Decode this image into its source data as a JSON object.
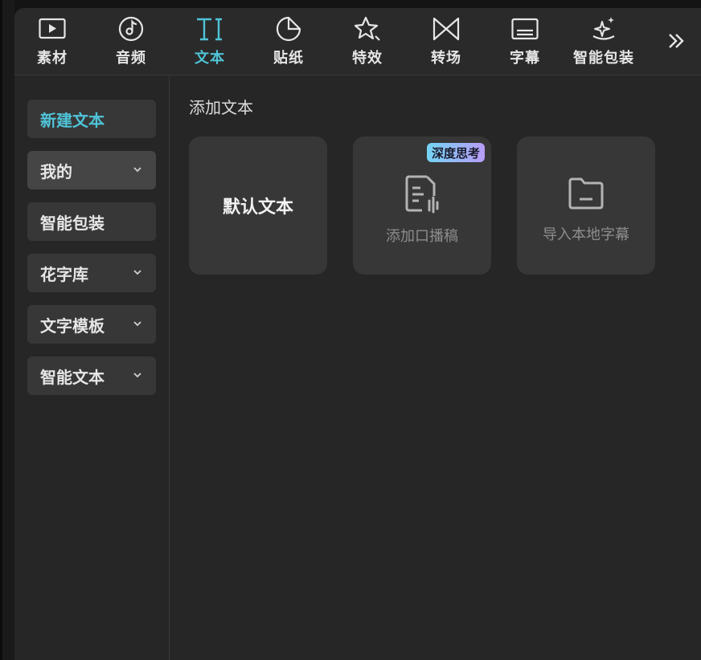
{
  "tabs": [
    {
      "label": "素材",
      "icon": "media-play-icon",
      "active": false
    },
    {
      "label": "音频",
      "icon": "music-note-icon",
      "active": false
    },
    {
      "label": "文本",
      "icon": "text-ti-icon",
      "active": true
    },
    {
      "label": "贴纸",
      "icon": "sticker-icon",
      "active": false
    },
    {
      "label": "特效",
      "icon": "star-sparkle-icon",
      "active": false
    },
    {
      "label": "转场",
      "icon": "transition-bowtie-icon",
      "active": false
    },
    {
      "label": "字幕",
      "icon": "subtitle-icon",
      "active": false
    },
    {
      "label": "智能包装",
      "icon": "magic-wand-icon",
      "active": false
    }
  ],
  "more_icon": "double-chevron-right-icon",
  "sidebar": {
    "items": [
      {
        "label": "新建文本",
        "active": true,
        "has_chevron": false
      },
      {
        "label": "我的",
        "active": false,
        "has_chevron": true
      },
      {
        "label": "智能包装",
        "active": false,
        "has_chevron": false
      },
      {
        "label": "花字库",
        "active": false,
        "has_chevron": true
      },
      {
        "label": "文字模板",
        "active": false,
        "has_chevron": true
      },
      {
        "label": "智能文本",
        "active": false,
        "has_chevron": true
      }
    ]
  },
  "main": {
    "section_title": "添加文本",
    "cards": [
      {
        "title": "默认文本"
      },
      {
        "label": "添加口播稿",
        "badge": "深度思考",
        "icon": "script-audio-icon"
      },
      {
        "label": "导入本地字幕",
        "icon": "folder-icon"
      }
    ]
  },
  "colors": {
    "accent": "#4fc3d7",
    "background": "#262626",
    "card": "#373737"
  }
}
